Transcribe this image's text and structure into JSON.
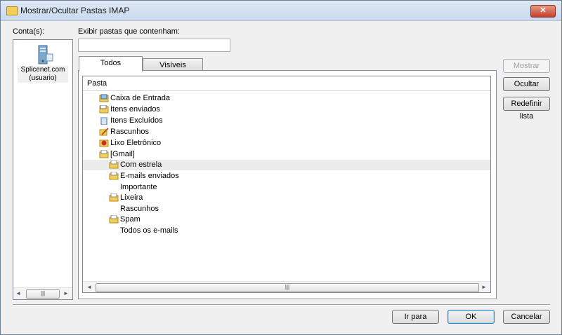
{
  "window": {
    "title": "Mostrar/Ocultar Pastas IMAP",
    "close_glyph": "✕"
  },
  "accounts": {
    "label": "Conta(s):",
    "items": [
      {
        "name": "Splicenet.com",
        "user": "(usuario)",
        "icon": "server-icon"
      }
    ],
    "scroll_thumb": "|||"
  },
  "filter": {
    "label": "Exibir pastas que contenham:",
    "value": ""
  },
  "tabs": [
    {
      "label": "Todos",
      "active": true
    },
    {
      "label": "Visíveis",
      "active": false
    }
  ],
  "tree": {
    "column_header": "Pasta",
    "items": [
      {
        "label": "Caixa de Entrada",
        "level": 0,
        "icon": "inbox-icon"
      },
      {
        "label": "Itens enviados",
        "level": 0,
        "icon": "sent-folder-icon"
      },
      {
        "label": "Itens Excluídos",
        "level": 0,
        "icon": "deleted-items-icon"
      },
      {
        "label": "Rascunhos",
        "level": 0,
        "icon": "drafts-icon"
      },
      {
        "label": "Lixo Eletrônico",
        "level": 0,
        "icon": "junk-icon"
      },
      {
        "label": "[Gmail]",
        "level": 0,
        "icon": "folder-icon"
      },
      {
        "label": "Com estrela",
        "level": 1,
        "icon": "folder-icon",
        "highlighted": true
      },
      {
        "label": "E-mails enviados",
        "level": 1,
        "icon": "folder-icon"
      },
      {
        "label": "Importante",
        "level": 1,
        "icon": ""
      },
      {
        "label": "Lixeira",
        "level": 1,
        "icon": "folder-icon"
      },
      {
        "label": "Rascunhos",
        "level": 1,
        "icon": ""
      },
      {
        "label": "Spam",
        "level": 1,
        "icon": "folder-icon"
      },
      {
        "label": "Todos os e-mails",
        "level": 1,
        "icon": ""
      }
    ],
    "scroll_thumb": "|||"
  },
  "side_buttons": {
    "show": "Mostrar",
    "hide": "Ocultar",
    "reset": "Redefinir lista"
  },
  "footer_buttons": {
    "goto": "Ir para",
    "ok": "OK",
    "cancel": "Cancelar"
  },
  "colors": {
    "folder": "#f2cf5a",
    "selection": "#ececec",
    "close": "#c4402a"
  }
}
